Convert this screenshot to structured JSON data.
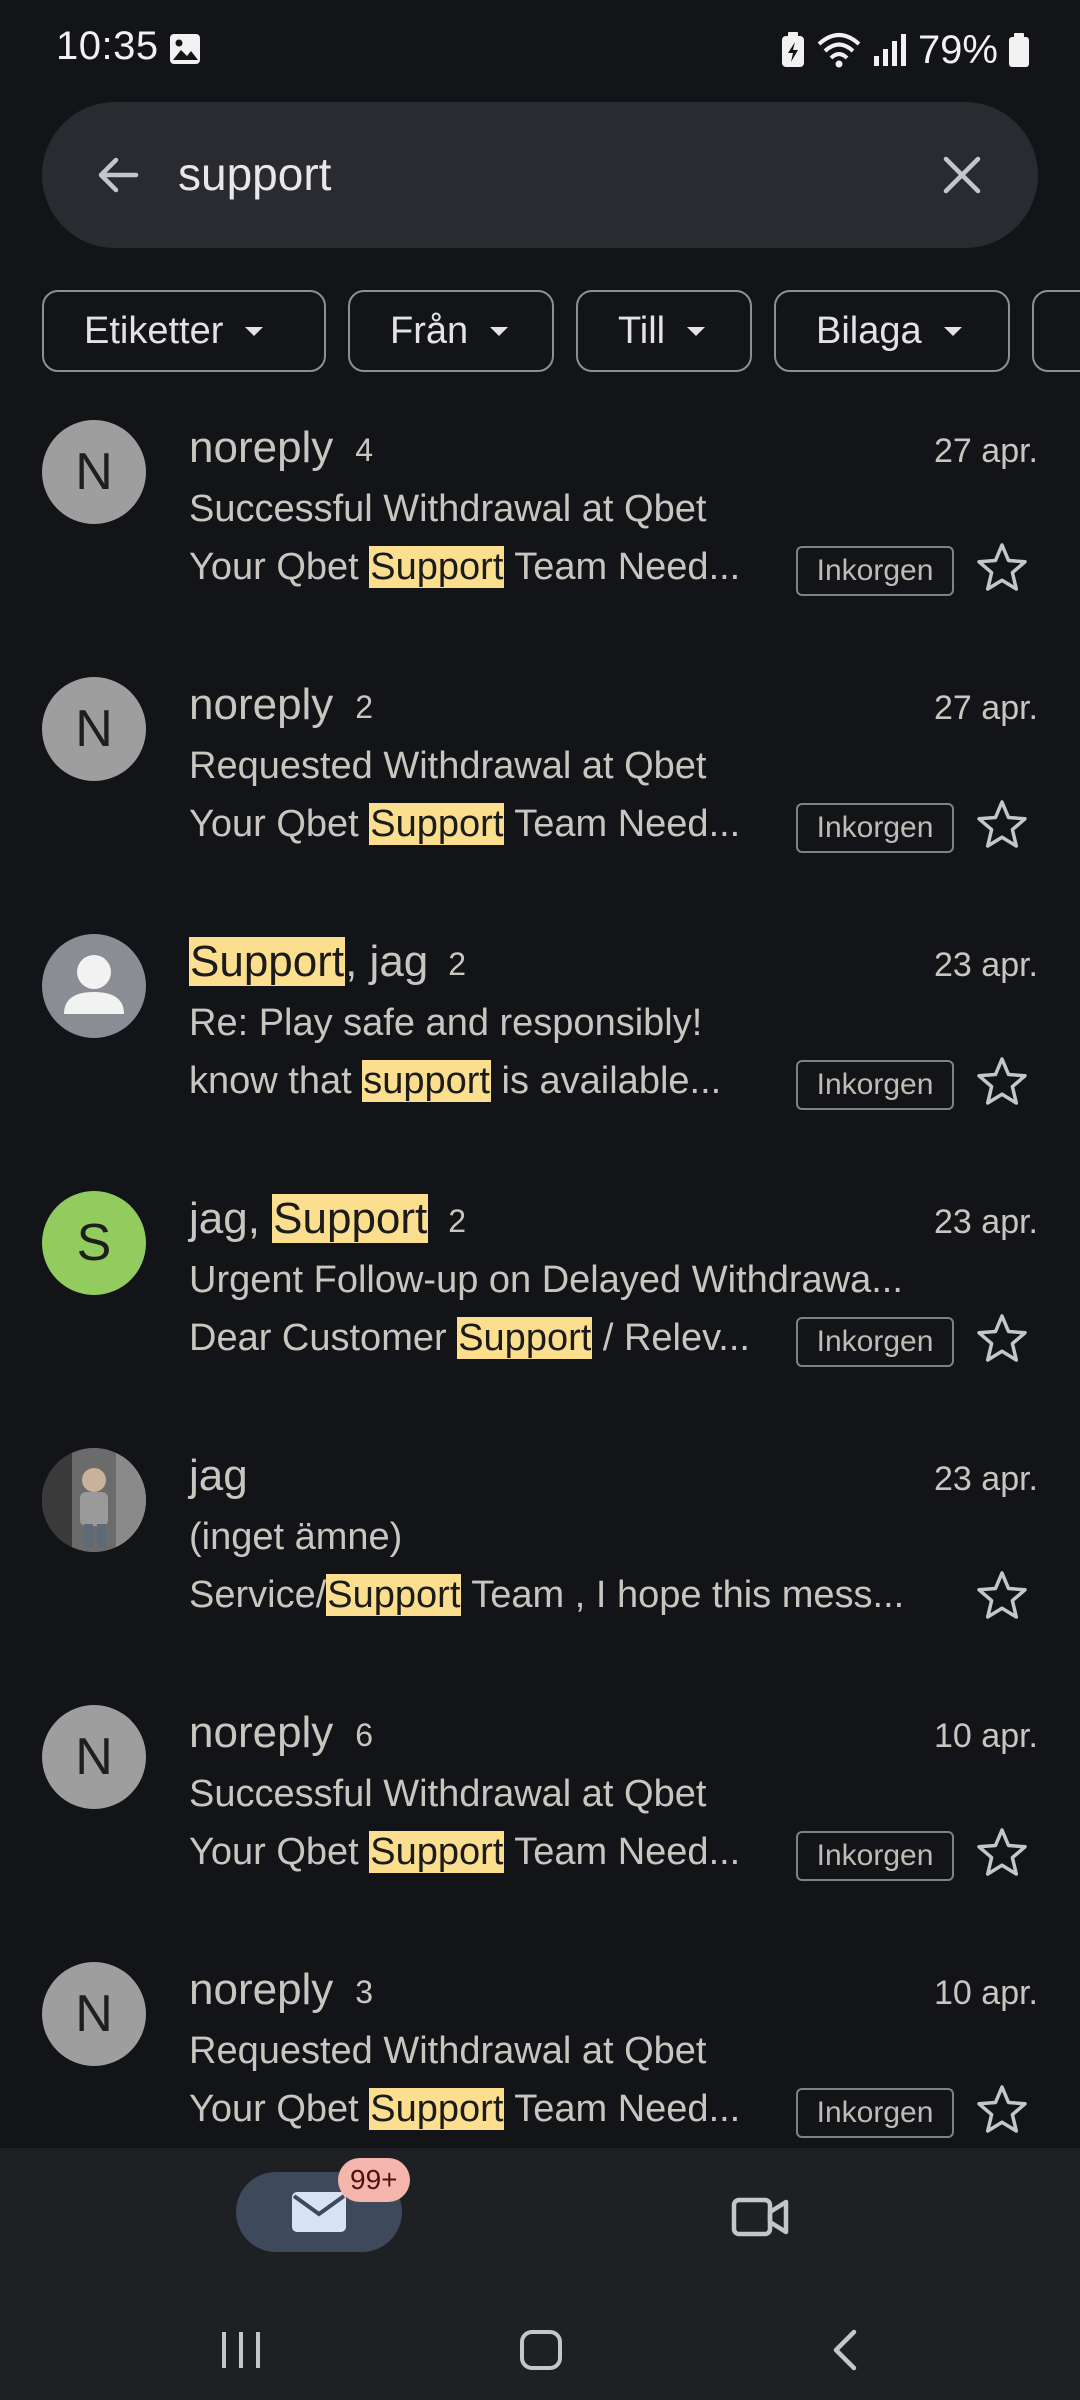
{
  "status_bar": {
    "time": "10:35",
    "battery": "79%",
    "icons": [
      "gallery-icon",
      "battery-saver-icon",
      "wifi-icon",
      "signal-icon",
      "battery-icon"
    ]
  },
  "search": {
    "query": "support",
    "back_icon": "arrow-back-icon",
    "clear_icon": "close-icon"
  },
  "filters": [
    {
      "label": "Etiketter"
    },
    {
      "label": "Från"
    },
    {
      "label": "Till"
    },
    {
      "label": "Bilaga"
    }
  ],
  "emails": [
    {
      "avatar": "N",
      "avatar_color": "#9e9e9e",
      "sender": [
        {
          "t": "noreply",
          "h": false
        }
      ],
      "count": "4",
      "date": "27 apr.",
      "subject": "Successful Withdrawal at Qbet",
      "snippet": [
        {
          "t": "Your Qbet ",
          "h": false
        },
        {
          "t": "Support",
          "h": true
        },
        {
          "t": " Team Need...",
          "h": false
        }
      ],
      "label": "Inkorgen"
    },
    {
      "avatar": "N",
      "avatar_color": "#9e9e9e",
      "sender": [
        {
          "t": "noreply",
          "h": false
        }
      ],
      "count": "2",
      "date": "27 apr.",
      "subject": "Requested Withdrawal at Qbet",
      "snippet": [
        {
          "t": "Your Qbet ",
          "h": false
        },
        {
          "t": "Support",
          "h": true
        },
        {
          "t": " Team Need...",
          "h": false
        }
      ],
      "label": "Inkorgen"
    },
    {
      "avatar": "person",
      "avatar_color": "#8a8d93",
      "sender": [
        {
          "t": "Support",
          "h": true
        },
        {
          "t": ", jag",
          "h": false
        }
      ],
      "count": "2",
      "date": "23 apr.",
      "subject": "Re: Play safe and responsibly!",
      "snippet": [
        {
          "t": "know that ",
          "h": false
        },
        {
          "t": "support",
          "h": true
        },
        {
          "t": " is available...",
          "h": false
        }
      ],
      "label": "Inkorgen"
    },
    {
      "avatar": "S",
      "avatar_color": "#93cc5e",
      "sender": [
        {
          "t": "jag, ",
          "h": false
        },
        {
          "t": "Support",
          "h": true
        }
      ],
      "count": "2",
      "date": "23 apr.",
      "subject": "Urgent Follow-up on Delayed Withdrawa...",
      "snippet": [
        {
          "t": "Dear Customer ",
          "h": false
        },
        {
          "t": "Support",
          "h": true
        },
        {
          "t": " / Relev...",
          "h": false
        }
      ],
      "label": "Inkorgen"
    },
    {
      "avatar": "photo",
      "avatar_color": "#5a5a5a",
      "sender": [
        {
          "t": "jag",
          "h": false
        }
      ],
      "count": "",
      "date": "23 apr.",
      "subject": "(inget ämne)",
      "snippet": [
        {
          "t": "Service/",
          "h": false
        },
        {
          "t": "Support",
          "h": true
        },
        {
          "t": " Team , I hope this mess...",
          "h": false
        }
      ],
      "label": ""
    },
    {
      "avatar": "N",
      "avatar_color": "#9e9e9e",
      "sender": [
        {
          "t": "noreply",
          "h": false
        }
      ],
      "count": "6",
      "date": "10 apr.",
      "subject": "Successful Withdrawal at Qbet",
      "snippet": [
        {
          "t": "Your Qbet ",
          "h": false
        },
        {
          "t": "Support",
          "h": true
        },
        {
          "t": " Team Need...",
          "h": false
        }
      ],
      "label": "Inkorgen"
    },
    {
      "avatar": "N",
      "avatar_color": "#9e9e9e",
      "sender": [
        {
          "t": "noreply",
          "h": false
        }
      ],
      "count": "3",
      "date": "10 apr.",
      "subject": "Requested Withdrawal at Qbet",
      "snippet": [
        {
          "t": "Your Qbet ",
          "h": false
        },
        {
          "t": "Support",
          "h": true
        },
        {
          "t": " Team Need...",
          "h": false
        }
      ],
      "label": "Inkorgen"
    }
  ],
  "bottom_nav": {
    "mail_badge": "99+",
    "tabs": [
      "mail-icon",
      "video-icon"
    ]
  },
  "colors": {
    "background": "#131418",
    "highlight": "#fcdf8e",
    "nav_background": "#1f2024",
    "active_tab": "#3e4a5c",
    "badge": "#f4b5ad"
  }
}
